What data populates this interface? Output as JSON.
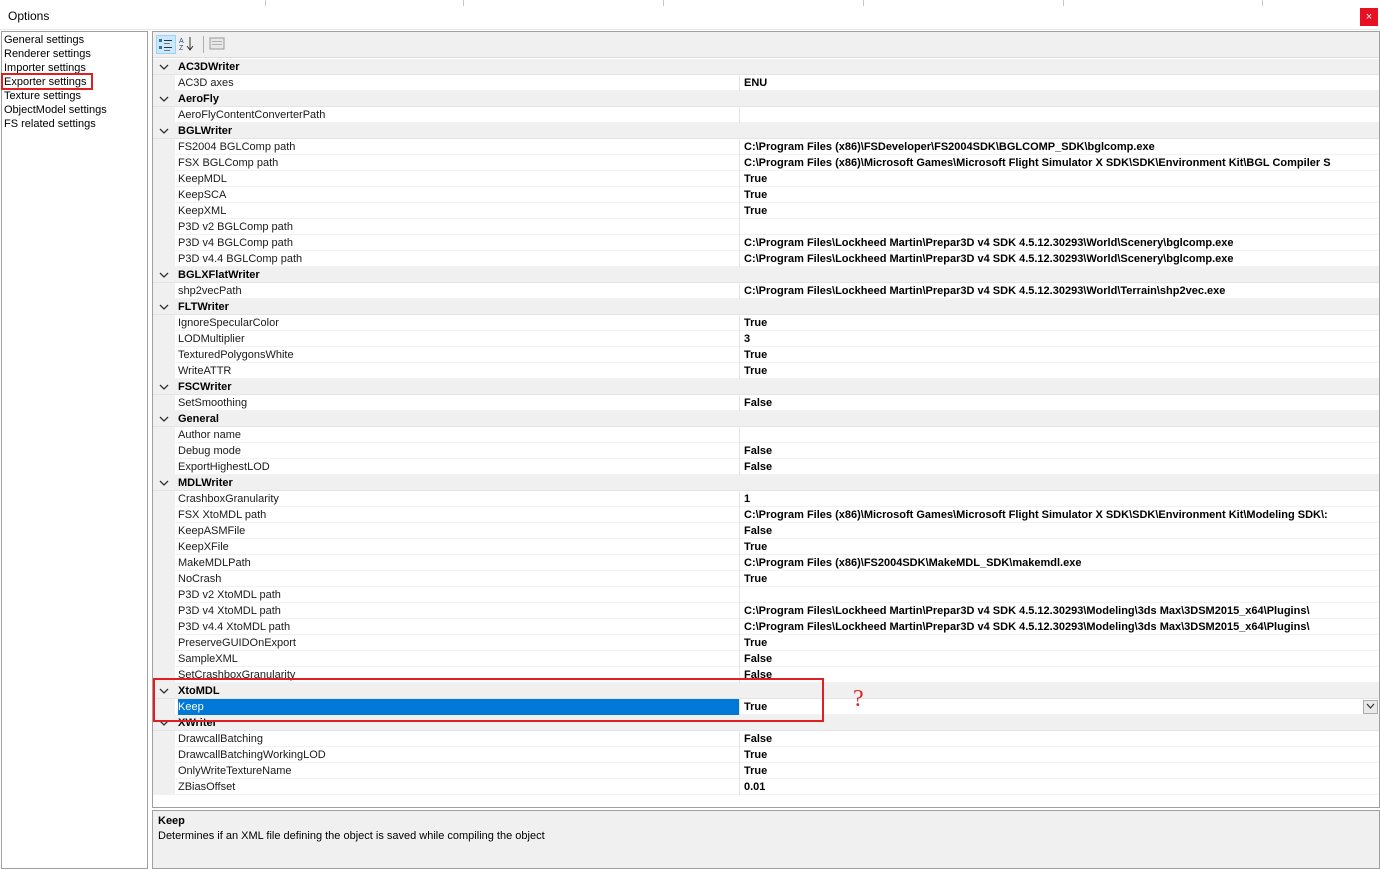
{
  "window": {
    "title": "Options",
    "close_label": "×"
  },
  "sidebar": {
    "items": [
      {
        "label": "General settings"
      },
      {
        "label": "Renderer settings"
      },
      {
        "label": "Importer settings"
      },
      {
        "label": "Exporter settings"
      },
      {
        "label": "Texture settings"
      },
      {
        "label": "ObjectModel settings"
      },
      {
        "label": "FS related settings"
      }
    ],
    "selected": "Exporter settings"
  },
  "toolbar": {
    "buttons": [
      {
        "name": "categorized-icon",
        "active": true
      },
      {
        "name": "alphabetical-icon",
        "active": false
      },
      {
        "name": "property-pages-icon",
        "active": false
      }
    ]
  },
  "grid": {
    "rows": [
      {
        "type": "cat",
        "label": "AC3DWriter"
      },
      {
        "type": "prop",
        "label": "AC3D axes",
        "value": "ENU"
      },
      {
        "type": "cat",
        "label": "AeroFly"
      },
      {
        "type": "prop",
        "label": "AeroFlyContentConverterPath",
        "value": ""
      },
      {
        "type": "cat",
        "label": "BGLWriter"
      },
      {
        "type": "prop",
        "label": "FS2004 BGLComp path",
        "value": "C:\\Program Files (x86)\\FSDeveloper\\FS2004SDK\\BGLCOMP_SDK\\bglcomp.exe"
      },
      {
        "type": "prop",
        "label": "FSX BGLComp path",
        "value": "C:\\Program Files (x86)\\Microsoft Games\\Microsoft Flight Simulator X SDK\\SDK\\Environment Kit\\BGL Compiler S"
      },
      {
        "type": "prop",
        "label": "KeepMDL",
        "value": "True"
      },
      {
        "type": "prop",
        "label": "KeepSCA",
        "value": "True"
      },
      {
        "type": "prop",
        "label": "KeepXML",
        "value": "True"
      },
      {
        "type": "prop",
        "label": "P3D v2 BGLComp path",
        "value": ""
      },
      {
        "type": "prop",
        "label": "P3D v4 BGLComp path",
        "value": "C:\\Program Files\\Lockheed Martin\\Prepar3D v4 SDK 4.5.12.30293\\World\\Scenery\\bglcomp.exe"
      },
      {
        "type": "prop",
        "label": "P3D v4.4 BGLComp path",
        "value": "C:\\Program Files\\Lockheed Martin\\Prepar3D v4 SDK 4.5.12.30293\\World\\Scenery\\bglcomp.exe"
      },
      {
        "type": "cat",
        "label": "BGLXFlatWriter"
      },
      {
        "type": "prop",
        "label": "shp2vecPath",
        "value": "C:\\Program Files\\Lockheed Martin\\Prepar3D v4 SDK 4.5.12.30293\\World\\Terrain\\shp2vec.exe"
      },
      {
        "type": "cat",
        "label": "FLTWriter"
      },
      {
        "type": "prop",
        "label": "IgnoreSpecularColor",
        "value": "True"
      },
      {
        "type": "prop",
        "label": "LODMultiplier",
        "value": "3"
      },
      {
        "type": "prop",
        "label": "TexturedPolygonsWhite",
        "value": "True"
      },
      {
        "type": "prop",
        "label": "WriteATTR",
        "value": "True"
      },
      {
        "type": "cat",
        "label": "FSCWriter"
      },
      {
        "type": "prop",
        "label": "SetSmoothing",
        "value": "False"
      },
      {
        "type": "cat",
        "label": "General"
      },
      {
        "type": "prop",
        "label": "Author name",
        "value": ""
      },
      {
        "type": "prop",
        "label": "Debug mode",
        "value": "False"
      },
      {
        "type": "prop",
        "label": "ExportHighestLOD",
        "value": "False"
      },
      {
        "type": "cat",
        "label": "MDLWriter"
      },
      {
        "type": "prop",
        "label": "CrashboxGranularity",
        "value": "1"
      },
      {
        "type": "prop",
        "label": "FSX XtoMDL path",
        "value": "C:\\Program Files (x86)\\Microsoft Games\\Microsoft Flight Simulator X SDK\\SDK\\Environment Kit\\Modeling SDK\\:"
      },
      {
        "type": "prop",
        "label": "KeepASMFile",
        "value": "False"
      },
      {
        "type": "prop",
        "label": "KeepXFile",
        "value": "True"
      },
      {
        "type": "prop",
        "label": "MakeMDLPath",
        "value": "C:\\Program Files (x86)\\FS2004SDK\\MakeMDL_SDK\\makemdl.exe"
      },
      {
        "type": "prop",
        "label": "NoCrash",
        "value": "True"
      },
      {
        "type": "prop",
        "label": "P3D v2 XtoMDL path",
        "value": ""
      },
      {
        "type": "prop",
        "label": "P3D v4 XtoMDL path",
        "value": "C:\\Program Files\\Lockheed Martin\\Prepar3D v4 SDK 4.5.12.30293\\Modeling\\3ds Max\\3DSM2015_x64\\Plugins\\"
      },
      {
        "type": "prop",
        "label": "P3D v4.4 XtoMDL path",
        "value": "C:\\Program Files\\Lockheed Martin\\Prepar3D v4 SDK 4.5.12.30293\\Modeling\\3ds Max\\3DSM2015_x64\\Plugins\\"
      },
      {
        "type": "prop",
        "label": "PreserveGUIDOnExport",
        "value": "True"
      },
      {
        "type": "prop",
        "label": "SampleXML",
        "value": "False"
      },
      {
        "type": "prop",
        "label": "SetCrashboxGranularity",
        "value": "False"
      },
      {
        "type": "cat",
        "label": "XtoMDL"
      },
      {
        "type": "prop",
        "label": "Keep",
        "value": "True",
        "selected": true
      },
      {
        "type": "cat",
        "label": "XWriter"
      },
      {
        "type": "prop",
        "label": "DrawcallBatching",
        "value": "False"
      },
      {
        "type": "prop",
        "label": "DrawcallBatchingWorkingLOD",
        "value": "True"
      },
      {
        "type": "prop",
        "label": "OnlyWriteTextureName",
        "value": "True"
      },
      {
        "type": "prop",
        "label": "ZBiasOffset",
        "value": "0.01"
      }
    ]
  },
  "description": {
    "title": "Keep",
    "text": "Determines if an XML file defining the object is saved while compiling the object"
  },
  "annotation": {
    "mark": "?"
  }
}
